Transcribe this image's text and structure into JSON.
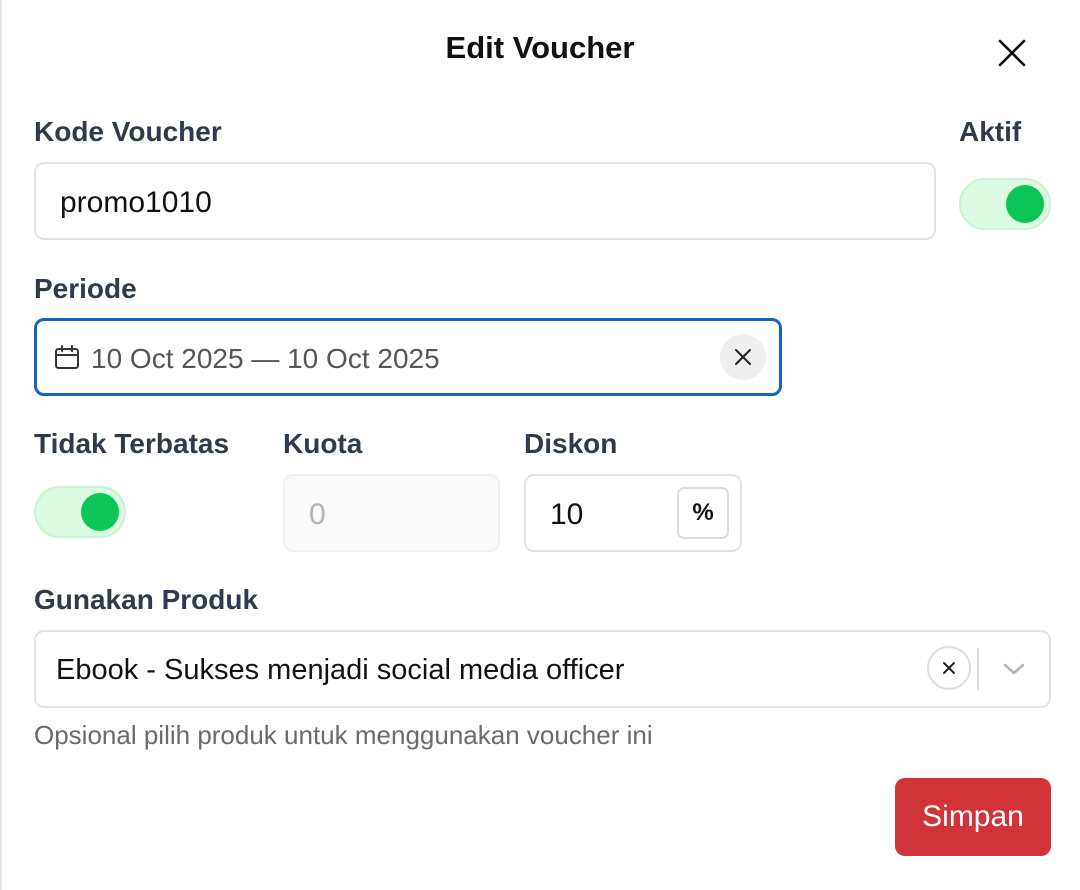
{
  "modal": {
    "title": "Edit Voucher"
  },
  "form": {
    "voucher_code": {
      "label": "Kode Voucher",
      "value": "promo1010"
    },
    "active": {
      "label": "Aktif",
      "on": true
    },
    "period": {
      "label": "Periode",
      "value": "10 Oct 2025 — 10 Oct 2025"
    },
    "unlimited": {
      "label": "Tidak Terbatas",
      "on": true
    },
    "quota": {
      "label": "Kuota",
      "value": "0"
    },
    "discount": {
      "label": "Diskon",
      "value": "10",
      "unit": "%"
    },
    "product": {
      "label": "Gunakan Produk",
      "value": "Ebook - Sukses menjadi social media officer",
      "helper": "Opsional pilih produk untuk menggunakan voucher ini"
    }
  },
  "actions": {
    "save_label": "Simpan"
  },
  "colors": {
    "toggle_on": "#0bc654",
    "focus_border": "#1565c0",
    "primary_button": "#d13438"
  }
}
